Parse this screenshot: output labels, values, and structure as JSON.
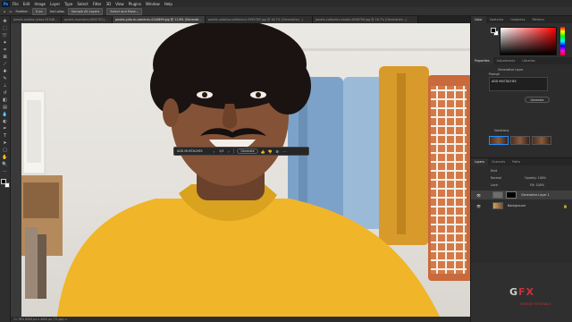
{
  "app": {
    "logo": "Ps"
  },
  "menu": [
    "File",
    "Edit",
    "Image",
    "Layer",
    "Type",
    "Select",
    "Filter",
    "3D",
    "View",
    "Plugins",
    "Window",
    "Help"
  ],
  "options_bar": {
    "sample_all": "Sample All Layers",
    "shift_edge": "Select and Mask...",
    "buttons": [
      "Feather:",
      "0 px",
      "Anti-alias",
      "Style:",
      "Normal",
      "Width:",
      "Height:"
    ]
  },
  "tabs": [
    {
      "label": "pexels-andrea-rpiazz-8194838.jpg @ 16.7% (Generative Layer 1, RGB/8)"
    },
    {
      "label": "pexels-monstera-8095703.jpg @ 25% (Generative Layer...)"
    },
    {
      "label": "pexels-julia-m-cameron-4144899.jpg @ 11.8% (Generative Layer 1, RGB/8)*"
    },
    {
      "label": "pexels-nataliya-vaitkevich-5990769.jpg @ 16.7% (Generative...)"
    },
    {
      "label": "pexels-cottonbro-studio-5698700.jpg @ 16.7% (Generative...)"
    }
  ],
  "active_tab_index": 2,
  "context_bar": {
    "prompt": "ADD MUSTACHES",
    "counter": "1/3",
    "generate": "Generate"
  },
  "status_bar": {
    "text": "11.76%   6000 px x 4000 px (72 ppi)   >"
  },
  "right_tabs": [
    "Color",
    "Swatches",
    "Gradients",
    "Patterns"
  ],
  "properties": {
    "tabs": [
      "Properties",
      "Adjustments",
      "Libraries"
    ],
    "layer_type": "Generative Layer",
    "prompt_label": "Prompt",
    "prompt_value": "ADD MUSTACHES",
    "generate_label": "Generate",
    "variations_label": "Variations"
  },
  "layers_panel": {
    "tabs": [
      "Layers",
      "Channels",
      "Paths"
    ],
    "kind_label": "Kind",
    "blend": "Normal",
    "opacity": "Opacity: 100%",
    "lock": "Lock:",
    "fill": "Fill: 100%",
    "rows": [
      {
        "name": "Generative Layer 1",
        "active": true
      },
      {
        "name": "Background",
        "active": false
      }
    ]
  },
  "watermark": {
    "text_a": "G",
    "text_x": "FX",
    "sub": "DESIGN TUTORIALS"
  }
}
